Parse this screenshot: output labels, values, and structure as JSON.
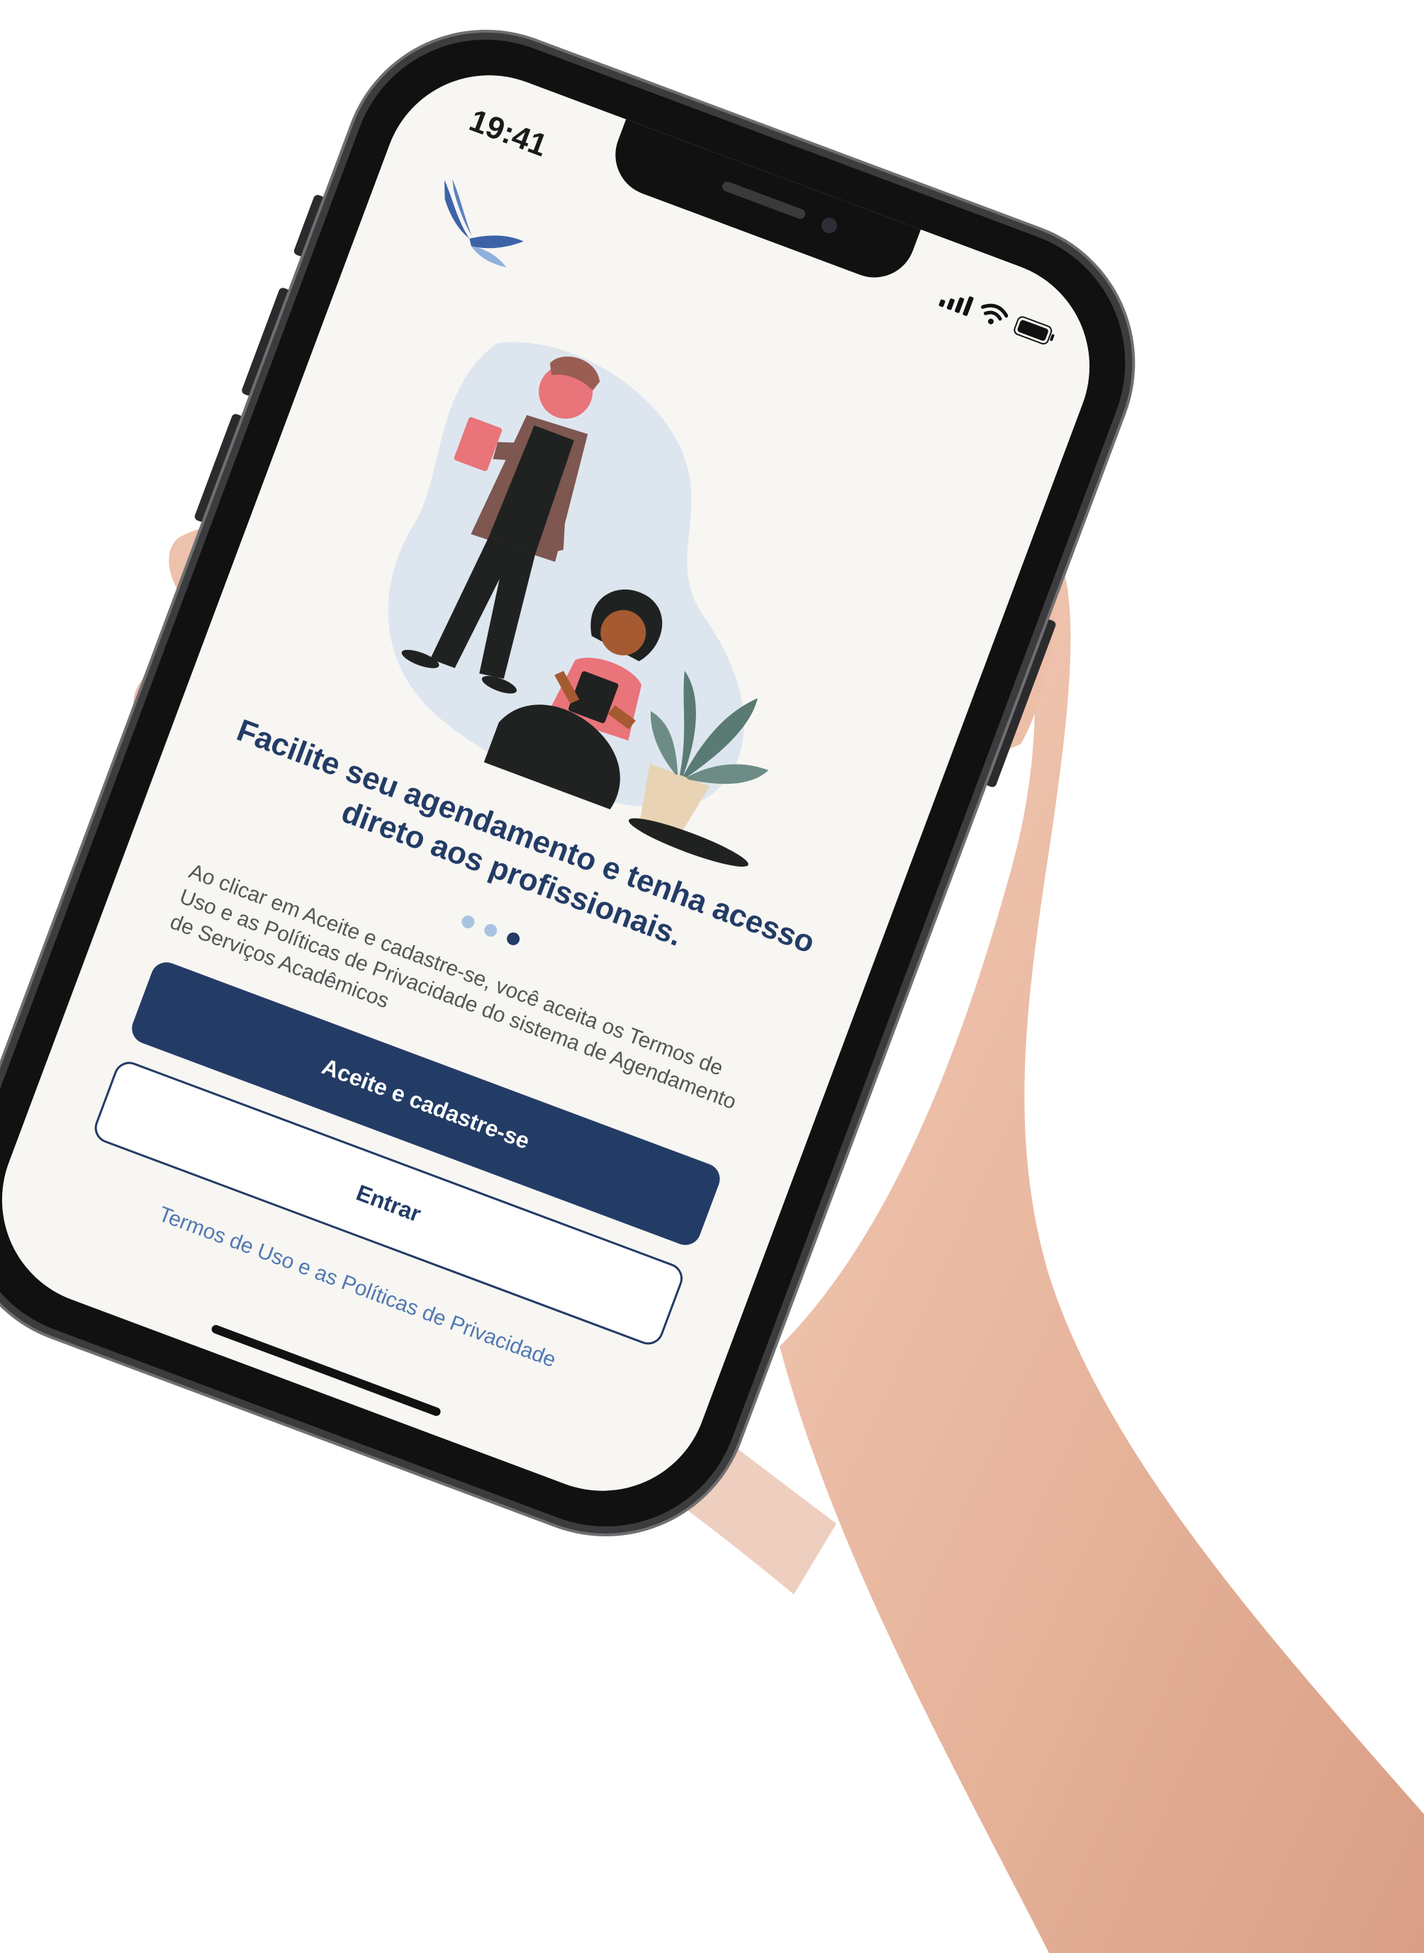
{
  "status_bar": {
    "time": "19:41"
  },
  "app": {
    "logo": "bird-wings-logo"
  },
  "onboarding": {
    "headline": "Facilite seu agendamento e tenha acesso direto aos profissionais.",
    "pagination": {
      "total": 3,
      "active": 3
    },
    "terms_notice": "Ao clicar em Aceite e cadastre-se, você aceita os Termos de Uso e as Políticas de Privacidade do sistema de Agendamento de Serviços Acadêmicos"
  },
  "actions": {
    "accept_label": "Aceite e cadastre-se",
    "login_label": "Entrar",
    "terms_link_label": "Termos de Uso e as Políticas de Privacidade"
  },
  "colors": {
    "primary": "#233c66",
    "link": "#4f79b2",
    "screen_background": "#f8f6f3",
    "dot_inactive": "#a9c4e0",
    "dot_active": "#233c66"
  },
  "icons": {
    "signal": "signal-icon",
    "wifi": "wifi-icon",
    "battery": "battery-icon"
  }
}
